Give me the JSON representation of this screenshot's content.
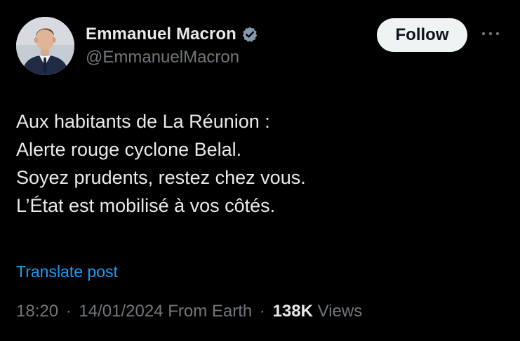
{
  "colors": {
    "background": "#000000",
    "text_primary": "#e7e9ea",
    "text_secondary": "#71767b",
    "link": "#1d9bf0",
    "verified_badge": "#829aab",
    "follow_bg": "#eff3f4"
  },
  "author": {
    "avatar_icon": "profile-photo",
    "name": "Emmanuel Macron",
    "verified_icon": "verified-badge-icon",
    "handle": "@EmmanuelMacron"
  },
  "actions": {
    "follow_label": "Follow",
    "more_icon": "more-options-icon"
  },
  "tweet": {
    "lines": [
      "Aux habitants de La Réunion :",
      "Alerte rouge cyclone Belal.",
      "Soyez prudents, restez chez vous.",
      "L’État est mobilisé à vos côtés."
    ],
    "translate_label": "Translate post"
  },
  "meta": {
    "time": "18:20",
    "separator": "·",
    "date": "14/01/2024",
    "source": "From Earth",
    "views_count": "138K",
    "views_label": "Views"
  }
}
